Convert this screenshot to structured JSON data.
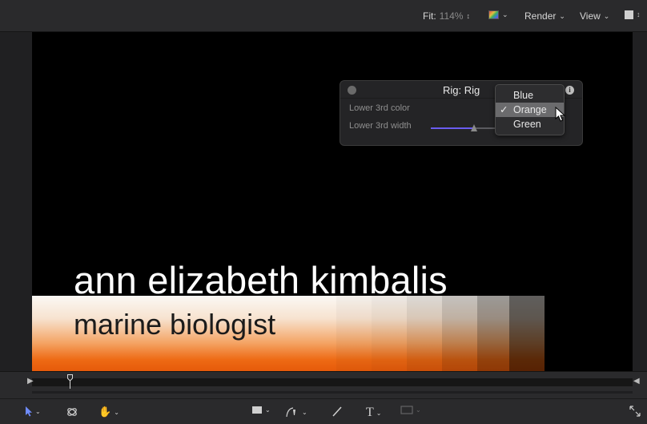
{
  "viewer": {
    "fit_label": "Fit:",
    "fit_value": "114%",
    "color_channels_icon": "color-channels-icon",
    "render_label": "Render",
    "view_label": "View",
    "layout_icon": "square-icon"
  },
  "lower_third": {
    "name": "ann elizabeth kimbalis",
    "title": "marine biologist"
  },
  "rig_hud": {
    "title": "Rig: Rig",
    "params": [
      {
        "label": "Lower 3rd color"
      },
      {
        "label": "Lower 3rd width",
        "slider_value": 0.45
      }
    ]
  },
  "popup_menu": {
    "items": [
      {
        "label": "Blue",
        "checked": false
      },
      {
        "label": "Orange",
        "checked": true
      },
      {
        "label": "Green",
        "checked": false
      }
    ],
    "check_mark": "✓"
  },
  "toolbar": {
    "tools": [
      "select-arrow-icon",
      "3d-transform-icon",
      "hand-pan-icon",
      "shape-rectangle-icon",
      "bezier-pen-icon",
      "paint-stroke-icon",
      "text-tool-icon",
      "mask-icon",
      "fullscreen-icon"
    ],
    "text_tool_glyph": "T"
  },
  "colors": {
    "accent": "#6f8cff",
    "slider_fill": "#6a5cf0",
    "lower_third_orange": "#e65a0a"
  }
}
